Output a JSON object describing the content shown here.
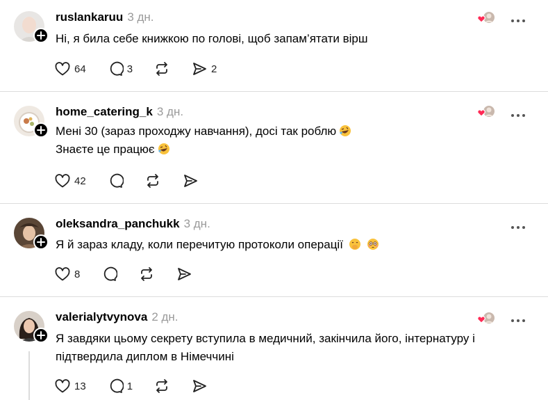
{
  "colors": {
    "heart": "#ff2a55",
    "divider": "#dcdcdc",
    "time": "#9a9a9a"
  },
  "posts": [
    {
      "username": "ruslankaruu",
      "time": "3 дн.",
      "lines": [
        "Ні, я била себе книжкою по голові, щоб запам’ятати вірш"
      ],
      "likes": "64",
      "replies": "3",
      "reposts": "",
      "shares": "2",
      "liked_by_author": true
    },
    {
      "username": "home_catering_k",
      "time": "3 дн.",
      "lines": [
        "Мені 30 (зараз проходжу навчання), досі так роблю",
        "Знаєте це працює"
      ],
      "likes": "42",
      "replies": "",
      "reposts": "",
      "shares": "",
      "liked_by_author": true
    },
    {
      "username": "oleksandra_panchukk",
      "time": "3 дн.",
      "lines": [
        "Я й зараз кладу, коли перечитую протоколи операції"
      ],
      "likes": "8",
      "replies": "",
      "reposts": "",
      "shares": "",
      "liked_by_author": false
    },
    {
      "username": "valerialytvynova",
      "time": "2 дн.",
      "lines": [
        "Я завдяки цьому секрету вступила в медичний, закінчила його, інтернатуру і",
        "підтвердила диплом в Німеччині"
      ],
      "likes": "13",
      "replies": "1",
      "reposts": "",
      "shares": "",
      "liked_by_author": true
    }
  ]
}
